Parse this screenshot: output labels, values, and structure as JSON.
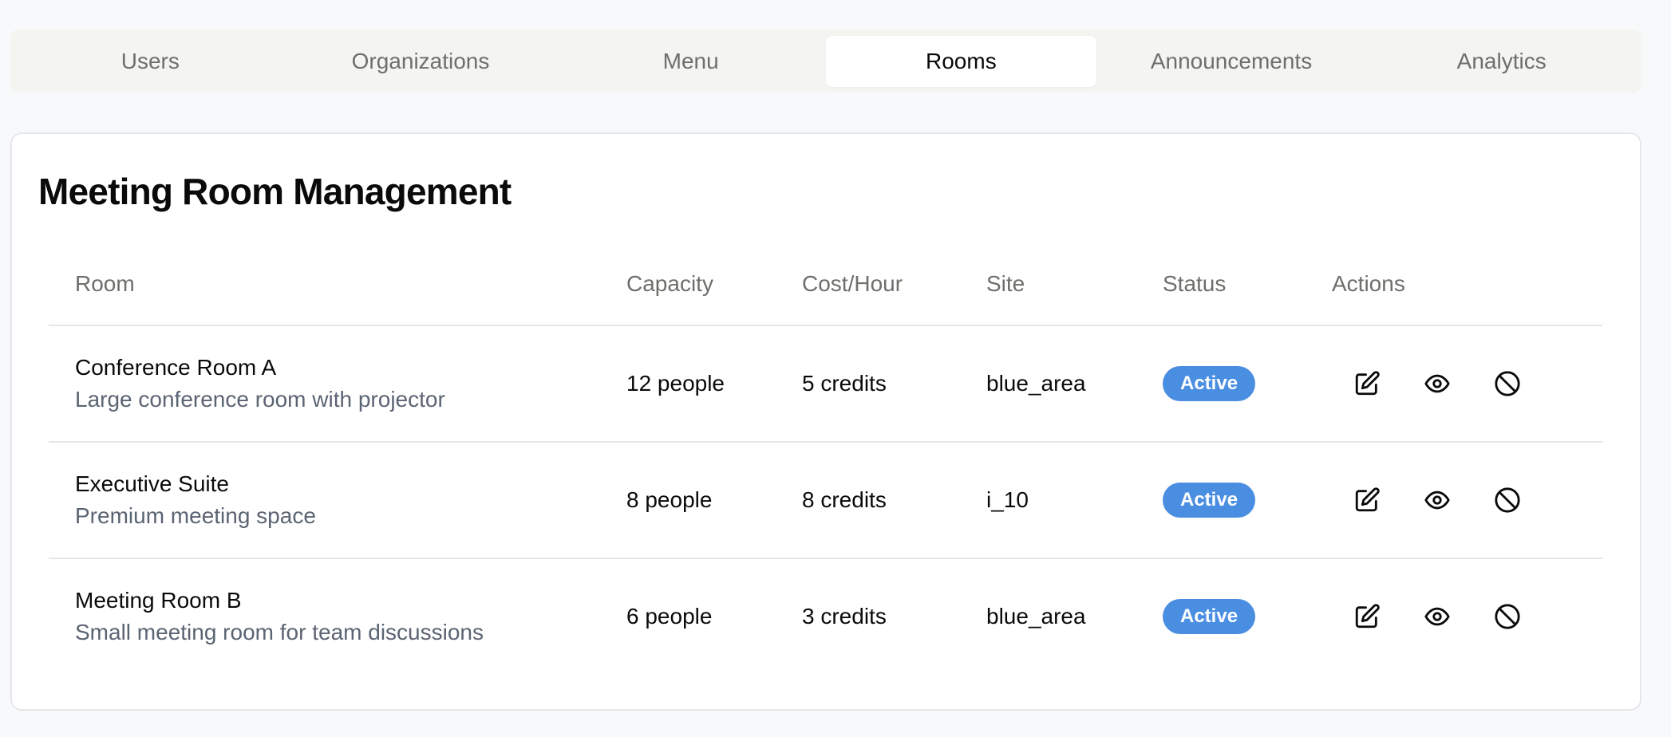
{
  "tabs": [
    {
      "label": "Users",
      "active": false
    },
    {
      "label": "Organizations",
      "active": false
    },
    {
      "label": "Menu",
      "active": false
    },
    {
      "label": "Rooms",
      "active": true
    },
    {
      "label": "Announcements",
      "active": false
    },
    {
      "label": "Analytics",
      "active": false
    }
  ],
  "card": {
    "title": "Meeting Room Management"
  },
  "table": {
    "headers": {
      "room": "Room",
      "capacity": "Capacity",
      "cost": "Cost/Hour",
      "site": "Site",
      "status": "Status",
      "actions": "Actions"
    },
    "rows": [
      {
        "name": "Conference Room A",
        "description": "Large conference room with projector",
        "capacity": "12 people",
        "cost": "5 credits",
        "site": "blue_area",
        "status": "Active"
      },
      {
        "name": "Executive Suite",
        "description": "Premium meeting space",
        "capacity": "8 people",
        "cost": "8 credits",
        "site": "i_10",
        "status": "Active"
      },
      {
        "name": "Meeting Room B",
        "description": "Small meeting room for team discussions",
        "capacity": "6 people",
        "cost": "3 credits",
        "site": "blue_area",
        "status": "Active"
      }
    ]
  },
  "icons": {
    "edit": "edit-icon",
    "view": "eye-icon",
    "disable": "ban-icon"
  },
  "colors": {
    "status_active": "#4a8ee2",
    "page_background": "#f8f9fb",
    "tabs_background": "#f4f4f1"
  }
}
